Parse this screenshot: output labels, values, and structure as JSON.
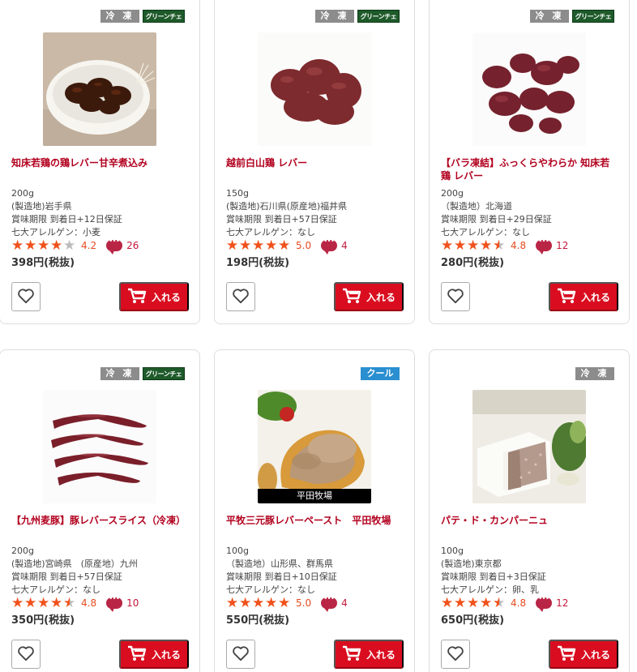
{
  "products": [
    {
      "tags": [
        {
          "text": "冷 凍",
          "kind": "frozen"
        },
        {
          "text": "グリーンチェック",
          "kind": "green"
        }
      ],
      "name": "知床若鶏の鶏レバー甘辛煮込み",
      "lines": [
        "200g",
        "(製造地)岩手県",
        "賞味期限 到着日+12日保証",
        "七大アレルゲン：小麦"
      ],
      "rating": 4.2,
      "rating_text": "4.2",
      "stars": [
        "full",
        "full",
        "full",
        "full",
        "empty"
      ],
      "reviews": "26",
      "price": "398円(税抜)",
      "cart_label": "入れる",
      "photo": "braised-liver-photo",
      "caption": ""
    },
    {
      "tags": [
        {
          "text": "冷 凍",
          "kind": "frozen"
        },
        {
          "text": "グリーンチェック",
          "kind": "green"
        }
      ],
      "name": "越前白山鶏 レバー",
      "lines": [
        "150g",
        "(製造地)石川県(原産地)福井県",
        "賞味期限 到着日+57日保証",
        "七大アレルゲン：なし"
      ],
      "rating": 5.0,
      "rating_text": "5.0",
      "stars": [
        "full",
        "full",
        "full",
        "full",
        "full"
      ],
      "reviews": "4",
      "price": "198円(税抜)",
      "cart_label": "入れる",
      "photo": "raw-chicken-liver-photo",
      "caption": ""
    },
    {
      "tags": [
        {
          "text": "冷 凍",
          "kind": "frozen"
        },
        {
          "text": "グリーンチェック",
          "kind": "green"
        }
      ],
      "name": "【バラ凍結】ふっくらやわらか 知床若鶏 レバー",
      "lines": [
        "200g",
        "（製造地）北海道",
        "賞味期限 到着日+29日保証",
        "七大アレルゲン：なし"
      ],
      "rating": 4.8,
      "rating_text": "4.8",
      "stars": [
        "full",
        "full",
        "full",
        "full",
        "half"
      ],
      "reviews": "12",
      "price": "280円(税抜)",
      "cart_label": "入れる",
      "photo": "frozen-liver-pieces-photo",
      "caption": ""
    },
    {
      "tags": [
        {
          "text": "冷 凍",
          "kind": "frozen"
        },
        {
          "text": "グリーンチェック",
          "kind": "green"
        }
      ],
      "name": "【九州麦豚】豚レバースライス（冷凍）",
      "lines": [
        "200g",
        "(製造地)宮崎県　(原産地）九州",
        "賞味期限 到着日+57日保証",
        "七大アレルゲン：なし"
      ],
      "rating": 4.8,
      "rating_text": "4.8",
      "stars": [
        "full",
        "full",
        "full",
        "full",
        "half"
      ],
      "reviews": "10",
      "price": "350円(税抜)",
      "cart_label": "入れる",
      "photo": "pork-liver-slices-photo",
      "caption": ""
    },
    {
      "tags": [
        {
          "text": "クール",
          "kind": "cool"
        }
      ],
      "name": "平牧三元豚レバーペースト　平田牧場",
      "lines": [
        "100g",
        "（製造地）山形県、群馬県",
        "賞味期限 到着日+10日保証",
        "七大アレルゲン：なし"
      ],
      "rating": 5.0,
      "rating_text": "5.0",
      "stars": [
        "full",
        "full",
        "full",
        "full",
        "full"
      ],
      "reviews": "4",
      "price": "550円(税抜)",
      "cart_label": "入れる",
      "photo": "liver-paste-toast-photo",
      "caption": "平田牧場"
    },
    {
      "tags": [
        {
          "text": "冷 凍",
          "kind": "frozen"
        }
      ],
      "name": "パテ・ド・カンパーニュ",
      "lines": [
        "100g",
        "(製造地)東京都",
        "賞味期限 到着日+3日保証",
        "七大アレルゲン：卵、乳"
      ],
      "rating": 4.8,
      "rating_text": "4.8",
      "stars": [
        "full",
        "full",
        "full",
        "full",
        "half"
      ],
      "reviews": "12",
      "price": "650円(税抜)",
      "cart_label": "入れる",
      "photo": "pate-de-campagne-photo",
      "caption": ""
    }
  ],
  "colors": {
    "accent": "#d90d1f",
    "name_text": "#b2001e",
    "star": "#f0511b",
    "frozen_tag": "#8c8c8c",
    "cool_tag": "#2a8fd0",
    "green_tag": "#1e5a2a"
  }
}
